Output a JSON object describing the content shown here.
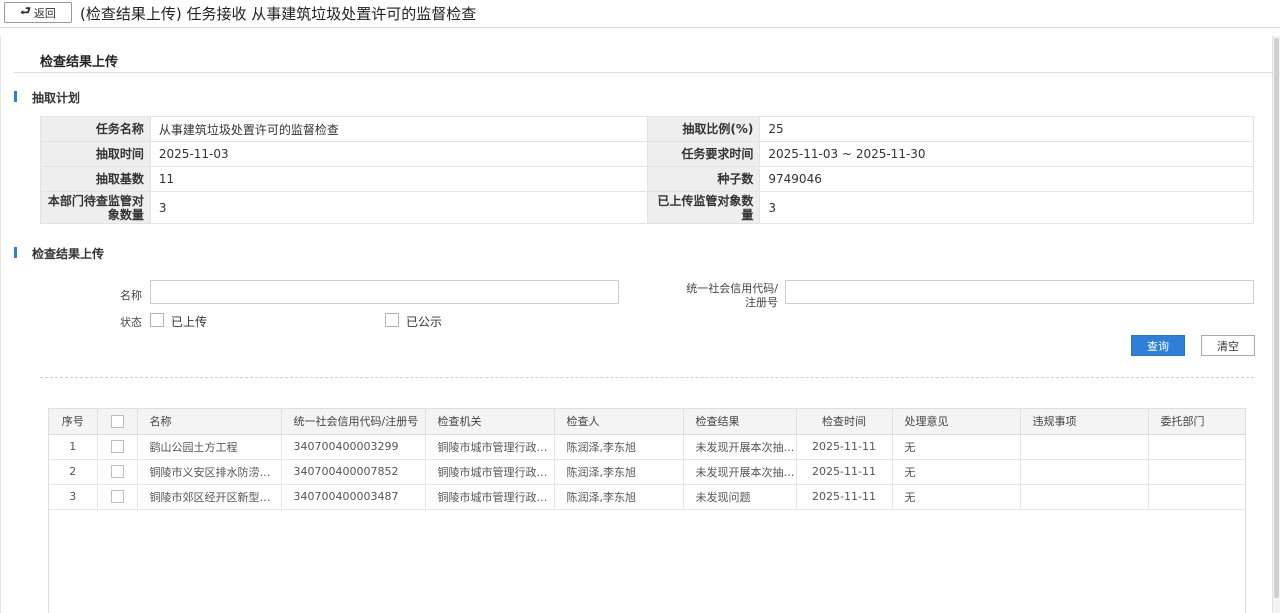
{
  "header": {
    "back_label": "返回",
    "back_icon": "return-arrow-icon",
    "title": "(检查结果上传) 任务接收 从事建筑垃圾处置许可的监督检查"
  },
  "section_title": "检查结果上传",
  "plan": {
    "subtitle": "抽取计划",
    "rows": [
      {
        "l1": "任务名称",
        "v1": "从事建筑垃圾处置许可的监督检查",
        "l2": "抽取比例(%)",
        "v2": "25"
      },
      {
        "l1": "抽取时间",
        "v1": "2025-11-03",
        "l2": "任务要求时间",
        "v2": "2025-11-03 ~ 2025-11-30"
      },
      {
        "l1": "抽取基数",
        "v1": "11",
        "l2": "种子数",
        "v2": "9749046"
      },
      {
        "l1": "本部门待查监管对象数量",
        "v1": "3",
        "l2": "已上传监管对象数量",
        "v2": "3"
      }
    ]
  },
  "upload": {
    "subtitle": "检查结果上传",
    "name_label": "名称",
    "name_value": "",
    "code_label": "统一社会信用代码/注册号",
    "code_value": "",
    "status_label": "状态",
    "status_opt1": "已上传",
    "status_opt2": "已公示",
    "query_label": "查询",
    "clear_label": "清空"
  },
  "grid": {
    "columns": [
      "序号",
      "",
      "名称",
      "统一社会信用代码/注册号",
      "检查机关",
      "检查人",
      "检查结果",
      "检查时间",
      "处理意见",
      "违规事项",
      "委托部门"
    ],
    "rows": [
      [
        "1",
        "",
        "鹞山公园土方工程",
        "340700400003299",
        "铜陵市城市管理行政执法局",
        "陈润泽,李东旭",
        "未发现开展本次抽查涉及的经营活动",
        "2025-11-11",
        "无",
        "",
        ""
      ],
      [
        "2",
        "",
        "铜陵市义安区排水防涝设施建设项目",
        "340700400007852",
        "铜陵市城市管理行政执法局",
        "陈润泽,李东旭",
        "未发现开展本次抽查涉及的经营活动",
        "2025-11-11",
        "无",
        "",
        ""
      ],
      [
        "3",
        "",
        "铜陵市郊区经开区新型制造产业园项目",
        "340700400003487",
        "铜陵市城市管理行政执法局",
        "陈润泽,李东旭",
        "未发现问题",
        "2025-11-11",
        "无",
        "",
        ""
      ]
    ]
  }
}
